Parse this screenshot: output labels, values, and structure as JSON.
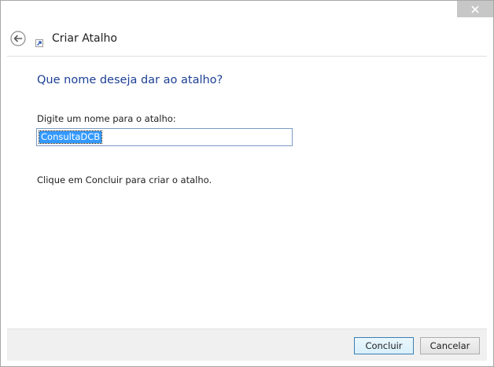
{
  "window": {
    "title": "Criar Atalho"
  },
  "icons": {
    "close": "close-icon",
    "back": "back-arrow-icon",
    "shortcut": "shortcut-arrow-icon"
  },
  "main": {
    "heading": "Que nome deseja dar ao atalho?",
    "name_label": "Digite um nome para o atalho:",
    "name_value": "ConsultaDCB",
    "instruction": "Clique em Concluir para criar o atalho."
  },
  "footer": {
    "finish_label": "Concluir",
    "cancel_label": "Cancelar"
  },
  "colors": {
    "heading": "#1c3f94",
    "selection": "#3399ff",
    "close_button": "#c7c7c7"
  }
}
